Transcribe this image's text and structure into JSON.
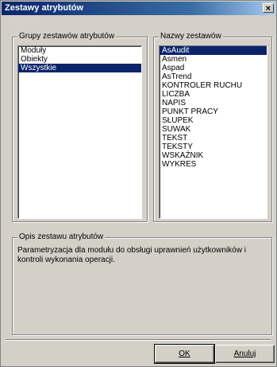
{
  "window": {
    "title": "Zestawy atrybutów",
    "close_label": "×"
  },
  "groups_box": {
    "legend": "Grupy zestawów atrybutów",
    "items": [
      "Moduły",
      "Obiekty",
      "Wszystkie"
    ],
    "selected_index": 2
  },
  "names_box": {
    "legend": "Nazwy zestawów",
    "items": [
      "AsAudit",
      "Asmen",
      "Aspad",
      "AsTrend",
      "KONTROLER RUCHU",
      "LICZBA",
      "NAPIS",
      "PUNKT PRACY",
      "SŁUPEK",
      "SUWAK",
      "TEKST",
      "TEKSTY",
      "WSKAŹNIK",
      "WYKRES"
    ],
    "selected_index": 0
  },
  "description_box": {
    "legend": "Opis zestawu atrybutów",
    "text": "Parametryzacja dla modułu do obsługi uprawnień użytkowników i kontroli wykonania operacji."
  },
  "buttons": {
    "ok_label": "OK",
    "cancel_label": "Anuluj"
  },
  "colors": {
    "selection": "#0a246a",
    "dialog_face": "#d4d0c8",
    "title_bar": "#0a246a"
  }
}
